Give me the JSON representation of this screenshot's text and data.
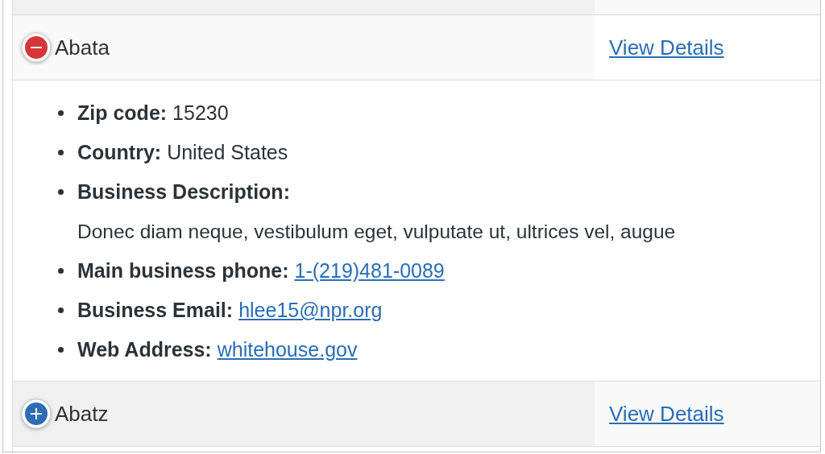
{
  "rows": [
    {
      "name": "Abata",
      "expanded": true,
      "link": "View Details",
      "details": [
        {
          "label": "Zip code:",
          "value": "15230",
          "kind": "text"
        },
        {
          "label": "Country:",
          "value": "United States",
          "kind": "text"
        },
        {
          "label": "Business Description:",
          "value": "Donec diam neque, vestibulum eget, vulputate ut, ultrices vel, augue",
          "kind": "block"
        },
        {
          "label": "Main business phone:",
          "value": "1-(219)481-0089",
          "kind": "link"
        },
        {
          "label": "Business Email:",
          "value": "hlee15@npr.org",
          "kind": "link"
        },
        {
          "label": "Web Address:",
          "value": "whitehouse.gov",
          "kind": "link"
        }
      ]
    },
    {
      "name": "Abatz",
      "expanded": false,
      "link": "View Details"
    }
  ]
}
